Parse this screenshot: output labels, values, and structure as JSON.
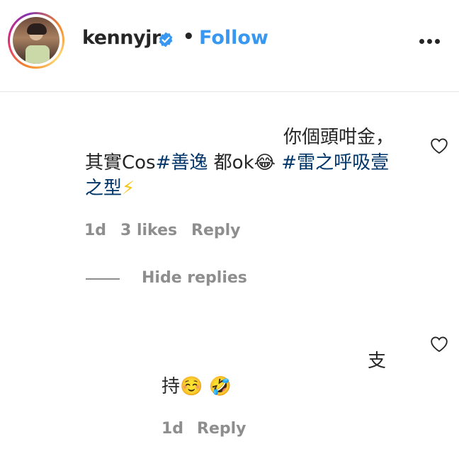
{
  "header": {
    "username": "kennyjr",
    "separator": "•",
    "follow_label": "Follow",
    "verified": true,
    "accent_color": "#3897f0"
  },
  "comment": {
    "line1": "你個頭咁金，",
    "line2_prefix": "其實Cos",
    "line2_tag1": "#善逸",
    "line2_mid": " 都ok😂 ",
    "line2_tag2": "#雷之呼吸壹",
    "line3_tag_cont": "之型",
    "line3_emoji": "⚡",
    "time": "1d",
    "likes": "3 likes",
    "reply_label": "Reply"
  },
  "hide_replies_label": "Hide replies",
  "reply": {
    "line1": "支",
    "line2": "持☺️ 🤣",
    "time": "1d",
    "reply_label": "Reply"
  },
  "icons": {
    "verified": "verified-badge-icon",
    "more": "more-options-icon",
    "like": "heart-outline-icon"
  }
}
